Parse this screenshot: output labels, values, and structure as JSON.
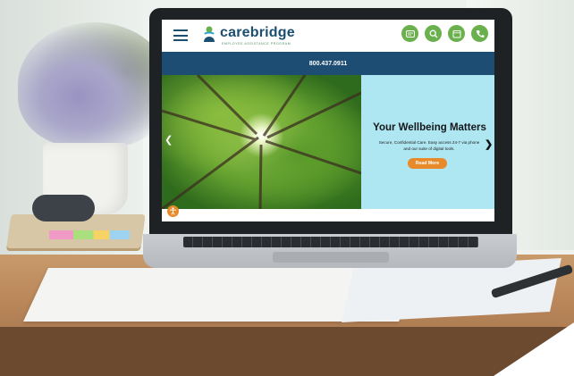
{
  "site": {
    "logo_name": "carebridge",
    "logo_tagline": "EMPLOYEE ASSISTANCE PROGRAM",
    "phone": "800.437.0911",
    "header_icons": [
      "chat-icon",
      "search-icon",
      "calendar-icon",
      "phone-icon"
    ],
    "hero": {
      "title": "Your Wellbeing Matters",
      "text": "Secure, Confidential Care. Easy access 24-7 via phone and our suite of digital tools.",
      "button": "Read More",
      "next": "❯",
      "prev": "❮"
    }
  },
  "colors": {
    "brand_navy": "#1d4d73",
    "brand_green": "#6ab04c",
    "hero_panel": "#aee6f1",
    "accent_orange": "#e98a2a"
  }
}
